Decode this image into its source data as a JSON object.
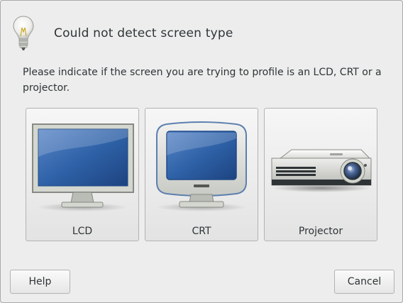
{
  "dialog": {
    "title": "Could not detect screen type",
    "message": "Please indicate if the screen you are trying to profile is an LCD, CRT or a projector.",
    "icon": "lightbulb-icon"
  },
  "choices": [
    {
      "id": "lcd",
      "label": "LCD",
      "icon": "lcd-monitor-icon"
    },
    {
      "id": "crt",
      "label": "CRT",
      "icon": "crt-monitor-icon"
    },
    {
      "id": "projector",
      "label": "Projector",
      "icon": "projector-icon"
    }
  ],
  "buttons": {
    "help": "Help",
    "cancel": "Cancel"
  },
  "colors": {
    "background": "#ededed",
    "text": "#2e3436",
    "screen_blue": "#2f62a8"
  }
}
